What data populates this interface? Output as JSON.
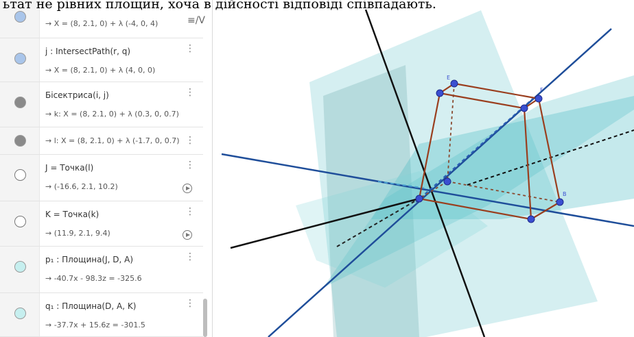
{
  "caption": "ьтат не рівних площин, хоча в дійсності відповіді співпадають.",
  "toggle_icon": "≡/V",
  "rows": [
    {
      "def": "",
      "value": "→ X = (8, 2.1, 0) + λ (-4, 0, 4)",
      "color": "#a9c5ea"
    },
    {
      "def": "j : IntersectPath(r, q)",
      "value": "→ X = (8, 2.1, 0) + λ (4, 0, 0)",
      "color": "#a9c5ea"
    },
    {
      "def": "Бісектриса(i, j)",
      "value": "→ k: X = (8, 2.1, 0) + λ (0.3, 0, 0.7)",
      "color": "#8a8a8a"
    },
    {
      "def": "",
      "value": "→ l: X = (8, 2.1, 0) + λ (-1.7, 0, 0.7)",
      "color": "#8a8a8a"
    },
    {
      "def": "J = Точка(l)",
      "value": "→ (-16.6, 2.1, 10.2)",
      "color": "#ffffff"
    },
    {
      "def": "K = Точка(k)",
      "value": "→ (11.9, 2.1, 9.4)",
      "color": "#ffffff"
    },
    {
      "def": "p₁ : Площина(J, D, A)",
      "value": "→ -40.7x - 98.3z = -325.6",
      "color": "#c6efef"
    },
    {
      "def": "q₁ : Площина(D, A, K)",
      "value": "→ -37.7x + 15.6z = -301.5",
      "color": "#c6efef"
    }
  ],
  "point_labels": [
    "E",
    "F",
    "B"
  ],
  "colors": {
    "edge": "#9a3e1e",
    "blue_line": "#1f4e9a",
    "black_line": "#111111",
    "plane": "#3fb6c0",
    "point": "#3a4fd1"
  }
}
